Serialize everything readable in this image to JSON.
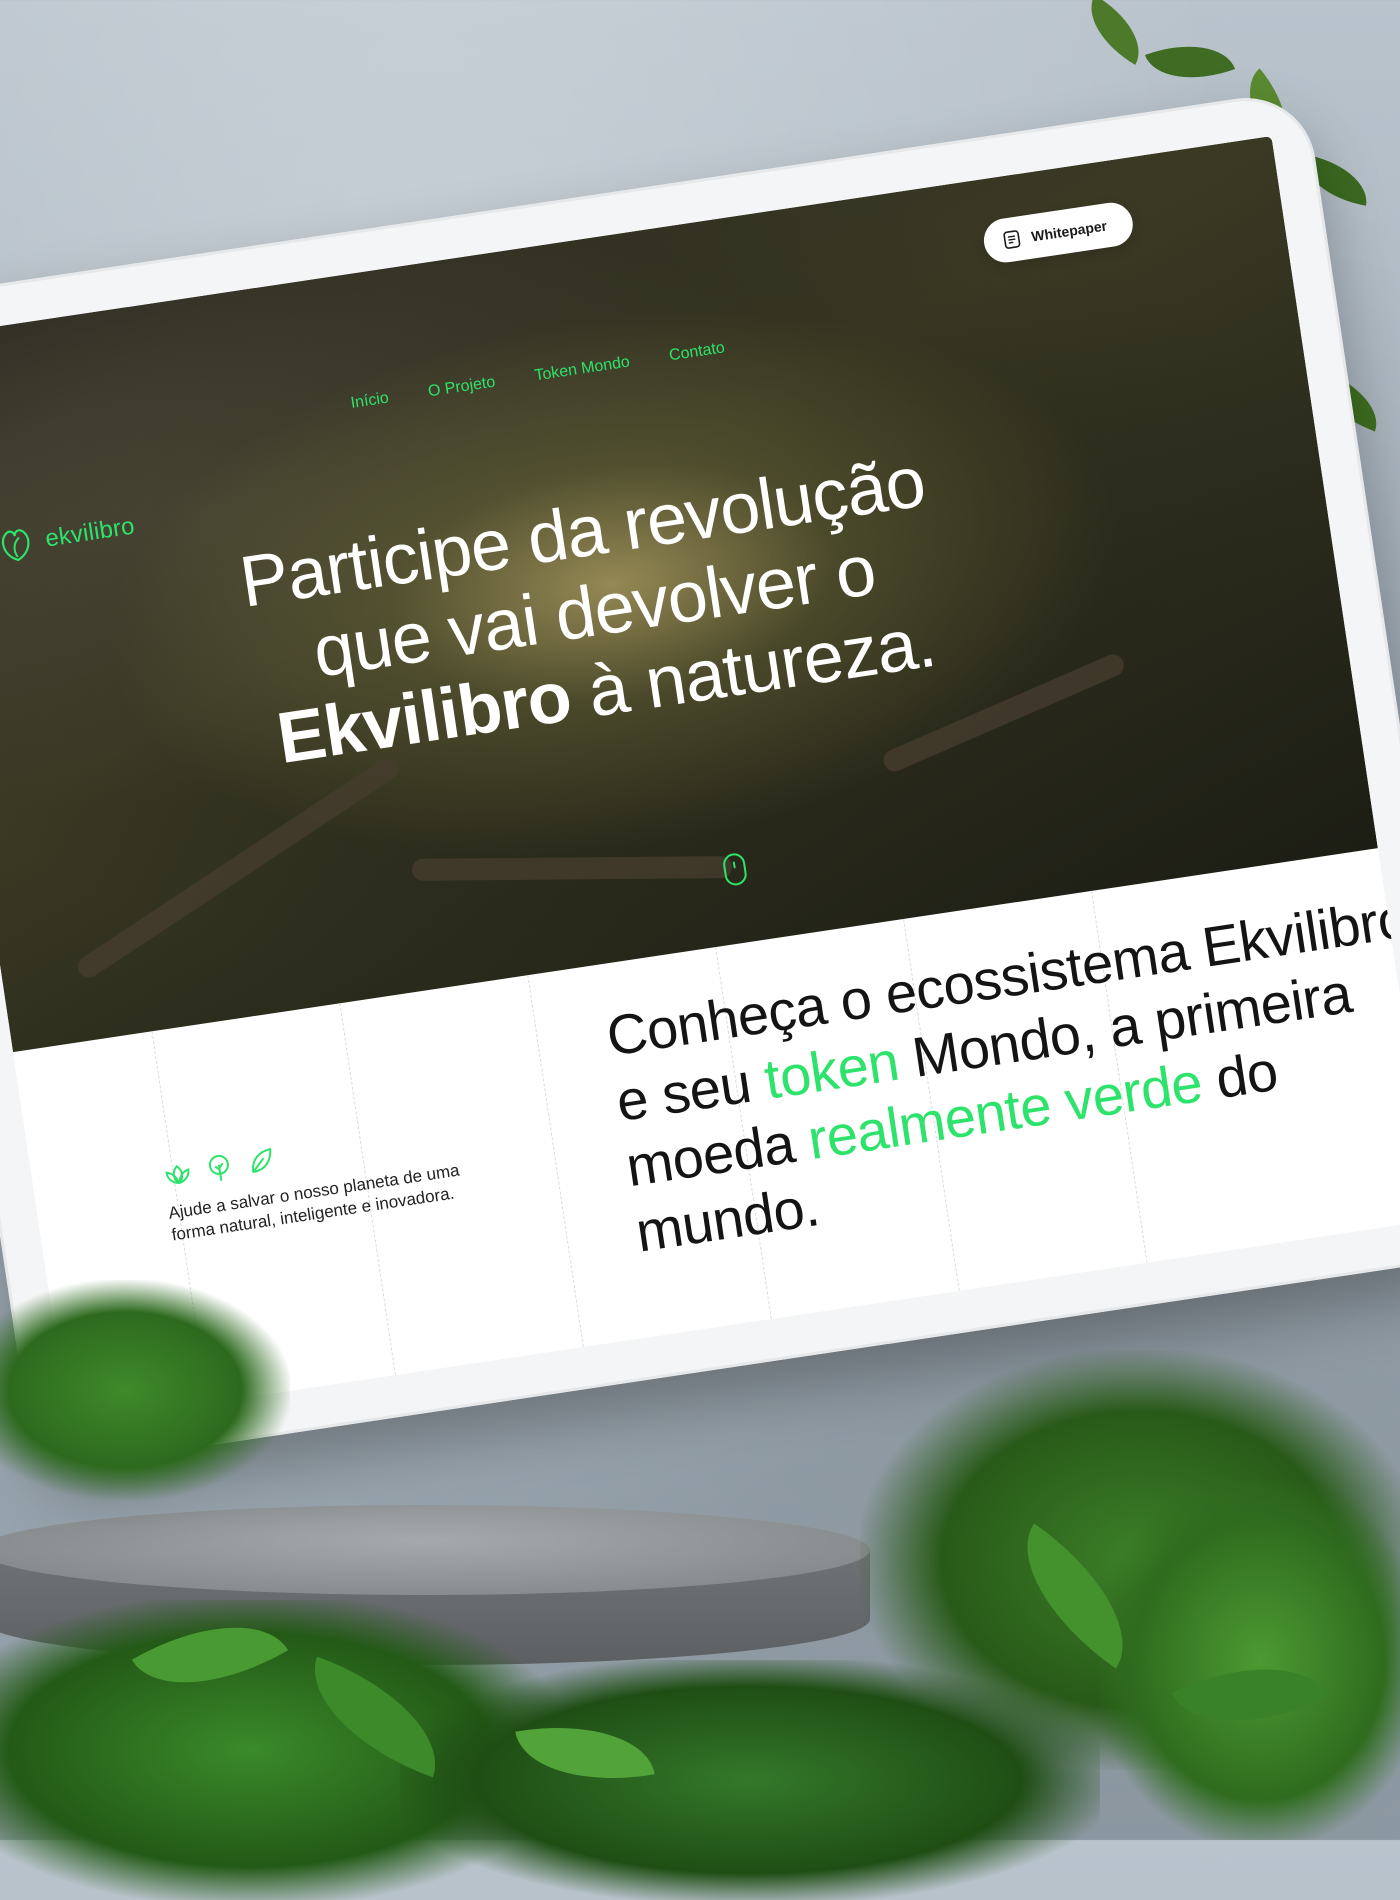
{
  "brand": {
    "name": "ekvilibro",
    "accent": "#2ee36b"
  },
  "nav": {
    "items": [
      "Início",
      "O Projeto",
      "Token Mondo",
      "Contato"
    ]
  },
  "whitepaper": {
    "label": "Whitepaper",
    "icon": "document-icon"
  },
  "hero": {
    "line1": "Participe da revolução",
    "line2": "que vai devolver o",
    "line3_bold": "Ekvilibro",
    "line3_rest": " à natureza."
  },
  "intro": {
    "icons": [
      "lotus-icon",
      "tree-icon",
      "leaf-icon"
    ],
    "text": "Ajude a salvar o nosso planeta de uma forma natural, inteligente e inovadora."
  },
  "tagline": {
    "p1": "Conheça o ecossistema Ekvilibro e seu ",
    "g1": "token",
    "p2": " Mondo, a primeira moeda ",
    "g2": "realmente verde",
    "p3": " do mundo."
  }
}
